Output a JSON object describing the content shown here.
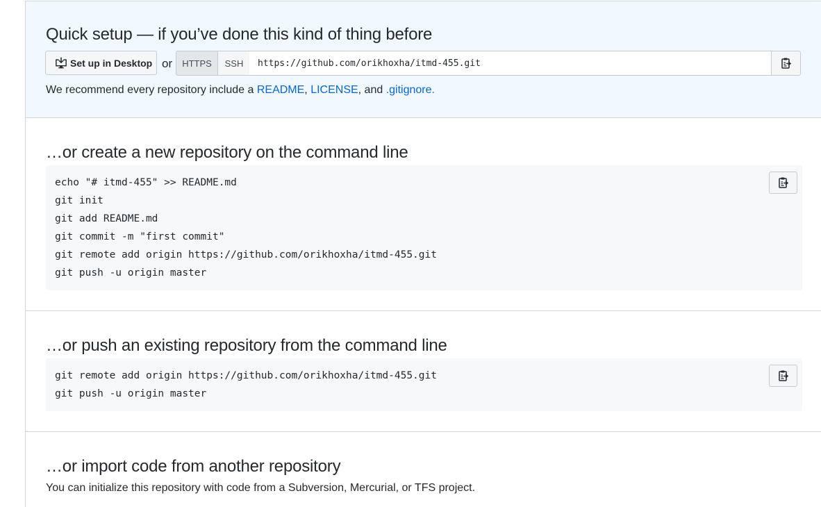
{
  "quick_setup": {
    "title": "Quick setup — if you’ve done this kind of thing before",
    "desktop_button": "Set up in Desktop",
    "or": "or",
    "https_tab": "HTTPS",
    "ssh_tab": "SSH",
    "clone_url": "https://github.com/orikhoxha/itmd-455.git",
    "recommend_prefix": "We recommend every repository include a ",
    "readme_link": "README",
    "comma1": ", ",
    "license_link": "LICENSE",
    "and": ", and ",
    "gitignore_link": ".gitignore",
    "period": "."
  },
  "create_new": {
    "title": "…or create a new repository on the command line",
    "lines": [
      "echo \"# itmd-455\" >> README.md",
      "git init",
      "git add README.md",
      "git commit -m \"first commit\"",
      "git remote add origin https://github.com/orikhoxha/itmd-455.git",
      "git push -u origin master"
    ]
  },
  "push_existing": {
    "title": "…or push an existing repository from the command line",
    "lines": [
      "git remote add origin https://github.com/orikhoxha/itmd-455.git",
      "git push -u origin master"
    ]
  },
  "import_code": {
    "title": "…or import code from another repository",
    "description": "You can initialize this repository with code from a Subversion, Mercurial, or TFS project."
  },
  "icons": {
    "desktop": "desktop-download-icon",
    "clipboard": "clipboard-icon"
  },
  "colors": {
    "quick_bg": "#f1f8ff",
    "link": "#0366d6",
    "code_bg": "#f6f8fa",
    "border": "#d1d5da"
  }
}
